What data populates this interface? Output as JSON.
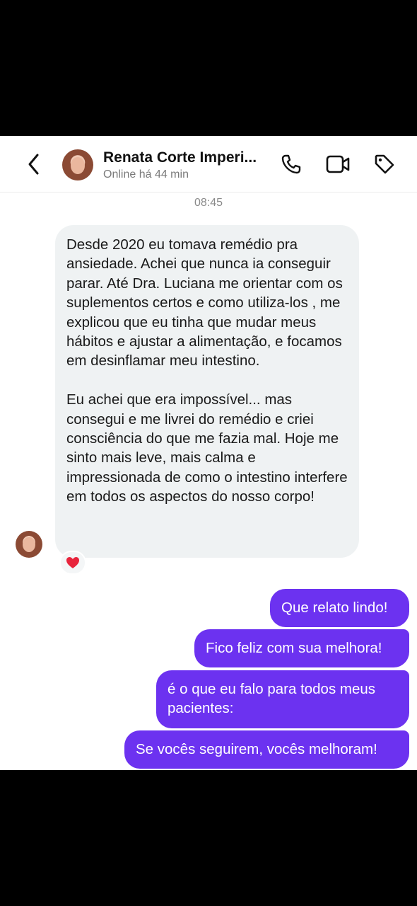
{
  "header": {
    "contact_name": "Renata Corte Imperi...",
    "status": "Online há 44 min",
    "icons": [
      "back-chevron-icon",
      "phone-icon",
      "video-camera-icon",
      "tag-icon"
    ]
  },
  "conversation": {
    "timestamp": "08:45",
    "incoming": {
      "paragraph_1": "Desde 2020 eu tomava remédio pra ansiedade. Achei que nunca ia conseguir parar. Até Dra. Luciana me orientar com os suplementos certos e como utiliza-los , me explicou que eu tinha que mudar meus hábitos e ajustar a alimentação, e focamos em desinflamar meu intestino.",
      "paragraph_2": "Eu achei que era impossível... mas consegui e me livrei do remédio e criei consciência do que me fazia mal. Hoje me sinto mais leve, mais calma e impressionada de como o intestino interfere em todos os aspectos do nosso corpo!",
      "reaction": "❤️"
    },
    "outgoing": [
      "Que relato lindo!",
      "Fico feliz com sua melhora!",
      "é o que eu falo para todos meus pacientes:",
      "Se vocês seguirem, vocês melhoram!"
    ]
  },
  "colors": {
    "outgoing_bubble": "#6c32f0",
    "incoming_bubble": "#eff2f3",
    "background": "#ffffff"
  }
}
